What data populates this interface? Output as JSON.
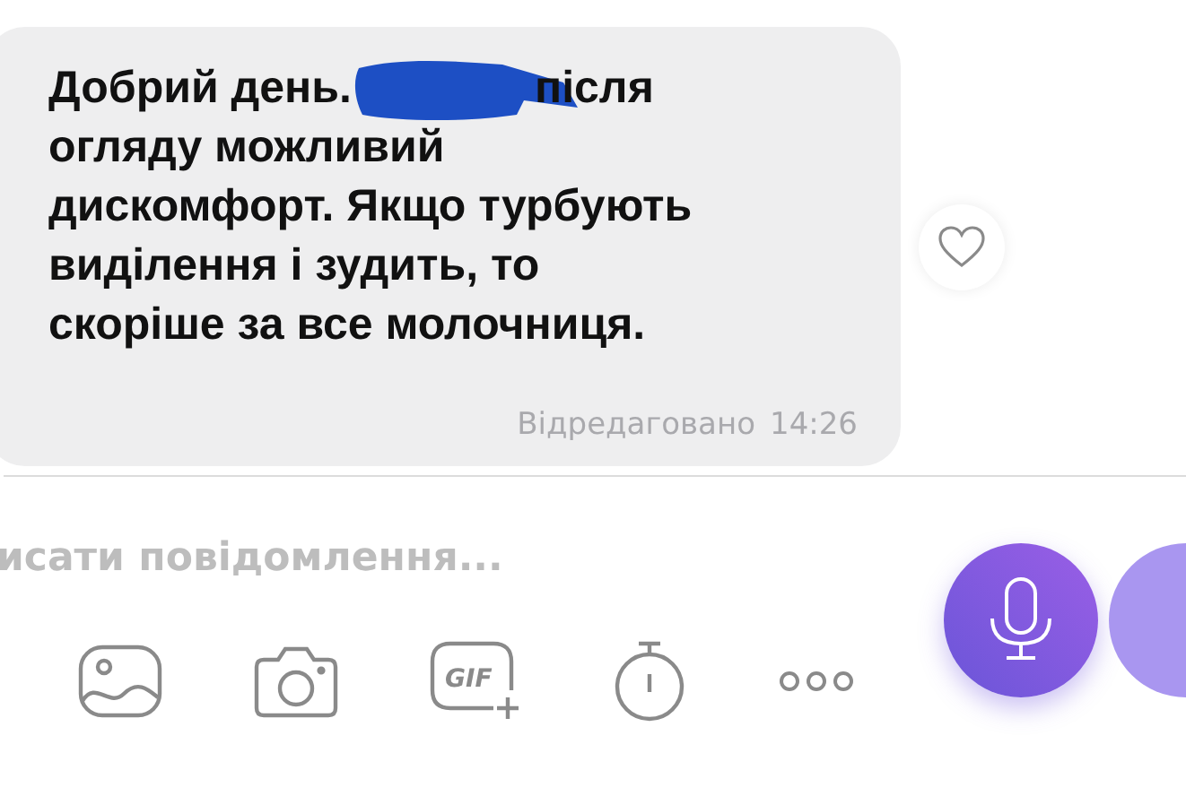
{
  "message": {
    "greeting": "Добрий день.",
    "lines": [
      "після",
      "огляду можливий",
      "дискомфорт. Якщо турбують",
      "виділення і зудить, то",
      "скоріше за все молочниця."
    ],
    "edited_label": "Відредаговано",
    "time": "14:26",
    "liked": false
  },
  "composer": {
    "placeholder": "исати повідомлення...",
    "gif_label": "GIF"
  }
}
